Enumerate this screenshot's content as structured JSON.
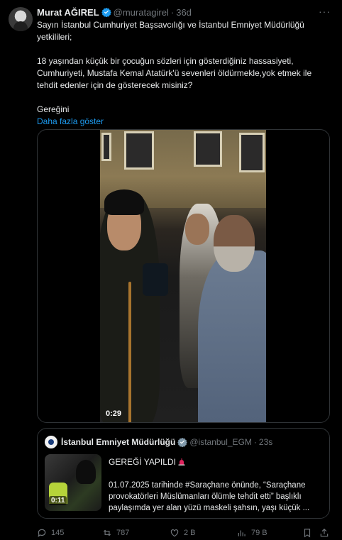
{
  "tweet": {
    "author_name": "Murat AĞIREL",
    "handle": "@muratagirel",
    "separator": "·",
    "age": "36d",
    "more": "···",
    "text_lines": [
      "Sayın İstanbul Cumhuriyet Başsavcılığı ve İstanbul Emniyet Müdürlüğü yetkilileri;",
      "",
      "18 yaşından küçük bir çocuğun sözleri için gösterdiğiniz hassasiyeti, Cumhuriyeti, Mustafa Kemal Atatürk'ü sevenleri öldürmekle,yok etmek ile tehdit edenler için de gösterecek misiniz?",
      "",
      "Gereğini"
    ],
    "show_more": "Daha fazla göster",
    "video_time": "0:29"
  },
  "quote": {
    "author_name": "İstanbul Emniyet Müdürlüğü",
    "handle": "@istanbul_EGM",
    "separator": "·",
    "age": "23s",
    "title": "GEREĞİ YAPILDI",
    "text": "01.07.2025 tarihinde #Saraçhane önünde, “Saraçhane provokatörleri Müslümanları ölümle tehdit etti” başlıklı paylaşımda yer alan yüzü maskeli şahsın, yaşı küçük ...",
    "video_time": "0:11"
  },
  "actions": {
    "replies": "145",
    "reposts": "787",
    "likes": "2 B",
    "views": "79 B"
  },
  "colors": {
    "accent": "#1d9bf0",
    "muted": "#71767b",
    "text": "#e7e9ea",
    "border": "#2f3336",
    "background": "#000000"
  },
  "icons": [
    "verified-badge-icon",
    "more-options-icon",
    "reply-icon",
    "repost-icon",
    "like-icon",
    "views-icon",
    "bookmark-icon",
    "share-icon",
    "siren-icon"
  ]
}
